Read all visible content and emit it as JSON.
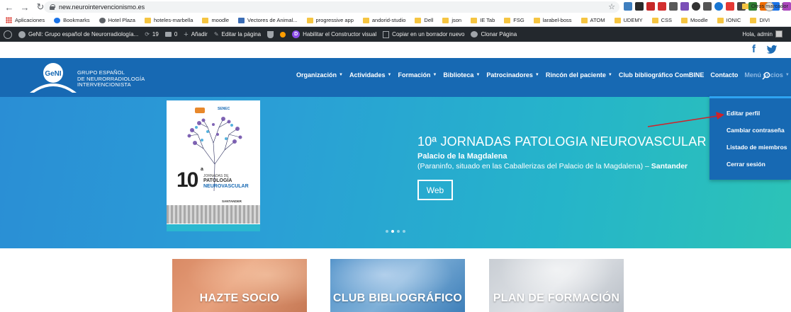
{
  "browser": {
    "url": "new.neurointervencionismo.es"
  },
  "bookmarks": [
    {
      "label": "Aplicaciones",
      "icon": "apps-icon"
    },
    {
      "label": "Bookmarks",
      "icon": "star-icon"
    },
    {
      "label": "Hotel Plaza",
      "icon": "globe-icon"
    },
    {
      "label": "hoteles-marbella",
      "icon": "folder-icon"
    },
    {
      "label": "moodle",
      "icon": "folder-icon"
    },
    {
      "label": "Vectores de Animal...",
      "icon": "shield-icon"
    },
    {
      "label": "progressive app",
      "icon": "folder-icon"
    },
    {
      "label": "andorid-studio",
      "icon": "folder-icon"
    },
    {
      "label": "Dell",
      "icon": "folder-icon"
    },
    {
      "label": "json",
      "icon": "folder-icon"
    },
    {
      "label": "IE Tab",
      "icon": "folder-icon"
    },
    {
      "label": "FSG",
      "icon": "folder-icon"
    },
    {
      "label": "larabel-boss",
      "icon": "folder-icon"
    },
    {
      "label": "ATOM",
      "icon": "folder-icon"
    },
    {
      "label": "UDEMY",
      "icon": "folder-icon"
    },
    {
      "label": "CSS",
      "icon": "folder-icon"
    },
    {
      "label": "Moodle",
      "icon": "folder-icon"
    },
    {
      "label": "IONIC",
      "icon": "folder-icon"
    },
    {
      "label": "DIVI",
      "icon": "folder-icon"
    }
  ],
  "bookmarks_more": "Otros marcador",
  "wpbar": {
    "site": "GeNI: Grupo español de Neurorradiología...",
    "updates": "19",
    "comments": "0",
    "add": "Añadir",
    "edit_page": "Editar la página",
    "builder": "Habilitar el Constructor visual",
    "copy_draft": "Copiar en un borrador nuevo",
    "clone": "Clonar Página",
    "howdy": "Hola, admin",
    "divi_letter": "D"
  },
  "header": {
    "logo_text": "GeNI",
    "org_lines": [
      "GRUPO ESPAÑOL",
      "DE NEURORRADIOLOGÍA",
      "INTERVENCIONISTA"
    ],
    "menu": [
      {
        "label": "Organización",
        "has_sub": true
      },
      {
        "label": "Actividades",
        "has_sub": true
      },
      {
        "label": "Formación",
        "has_sub": true
      },
      {
        "label": "Biblioteca",
        "has_sub": true
      },
      {
        "label": "Patrocinadores",
        "has_sub": true
      },
      {
        "label": "Rincón del paciente",
        "has_sub": true
      },
      {
        "label": "Club bibliográfico ComBINE",
        "has_sub": false
      },
      {
        "label": "Contacto",
        "has_sub": false
      },
      {
        "label": "Menú socios",
        "has_sub": true,
        "active": true
      }
    ]
  },
  "dropdown": [
    "Editar perfil",
    "Cambiar contraseña",
    "Listado de miembros",
    "Cerrar sesión"
  ],
  "hero": {
    "title": "10ª JORNADAS PATOLOGIA NEUROVASCULAR",
    "place": "Palacio de la Magdalena",
    "desc": "(Paraninfo, situado en las Caballerizas del Palacio de la Magdalena) – ",
    "city": "Santander",
    "button": "Web",
    "slides": 4,
    "active_slide": 1,
    "poster": {
      "number": "10",
      "ordinal": "a",
      "line1": "JORNADAS DE",
      "line2": "PATOLOGÍA",
      "line3": "NEUROVASCULAR",
      "location": "SANTANDER",
      "brand": "SENEC"
    }
  },
  "cards": [
    {
      "label": "HAZTE SOCIO"
    },
    {
      "label": "CLUB BIBLIOGRÁFICO"
    },
    {
      "label": "PLAN DE FORMACIÓN"
    }
  ],
  "colors": {
    "header_blue": "#1769b3",
    "wpbar": "#23282d",
    "annotation_arrow": "#d0222a"
  }
}
